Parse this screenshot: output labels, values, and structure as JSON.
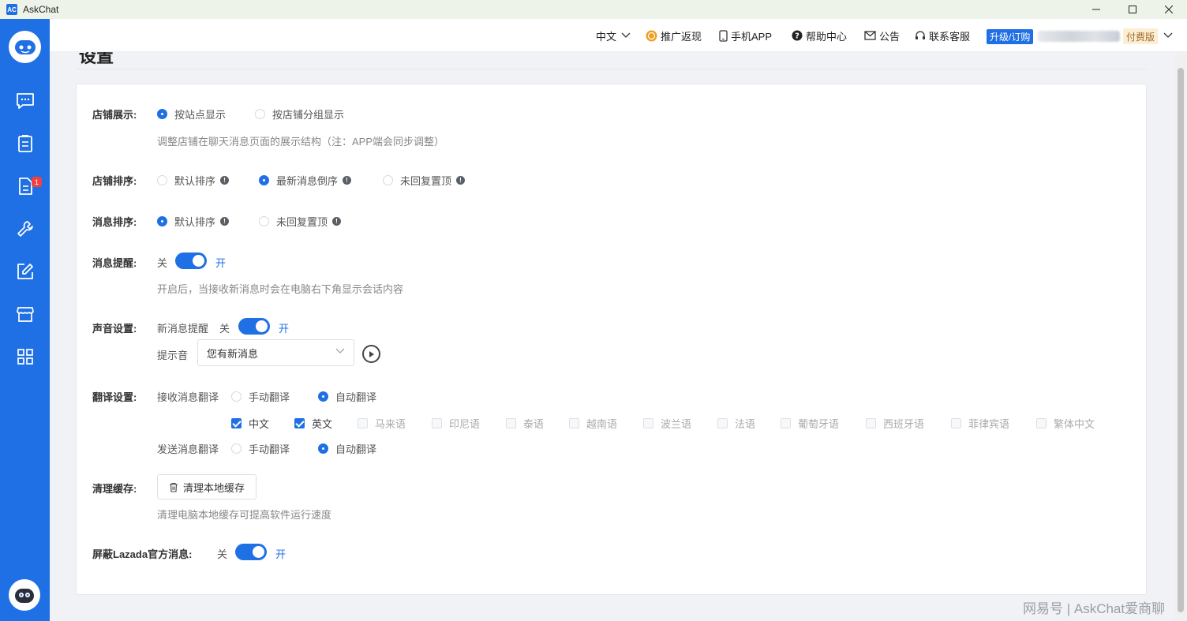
{
  "window": {
    "title": "AskChat",
    "app_icon_text": "AC"
  },
  "topbar": {
    "language": "中文",
    "promo": "推广返现",
    "mobile_app": "手机APP",
    "help": "帮助中心",
    "notice": "公告",
    "support": "联系客服",
    "upgrade": "升级/订购",
    "plan": "付费版"
  },
  "sidebar": {
    "badge": "1"
  },
  "page": {
    "title": "设置"
  },
  "settings": {
    "shop_display": {
      "label": "店铺展示:",
      "opt1": "按站点显示",
      "opt2": "按店铺分组显示",
      "hint": "调整店铺在聊天消息页面的展示结构（注：APP端会同步调整）"
    },
    "shop_sort": {
      "label": "店铺排序:",
      "opt1": "默认排序",
      "opt2": "最新消息倒序",
      "opt3": "未回复置顶"
    },
    "msg_sort": {
      "label": "消息排序:",
      "opt1": "默认排序",
      "opt2": "未回复置顶"
    },
    "msg_notify": {
      "label": "消息提醒:",
      "off": "关",
      "on": "开",
      "hint": "开启后，当接收新消息时会在电脑右下角显示会话内容"
    },
    "sound": {
      "label": "声音设置:",
      "new_msg": "新消息提醒",
      "off": "关",
      "on": "开",
      "tone_label": "提示音",
      "tone_value": "您有新消息"
    },
    "translate": {
      "label": "翻译设置:",
      "receive": "接收消息翻译",
      "send": "发送消息翻译",
      "manual": "手动翻译",
      "auto": "自动翻译",
      "languages": [
        "中文",
        "英文",
        "马来语",
        "印尼语",
        "泰语",
        "越南语",
        "波兰语",
        "法语",
        "葡萄牙语",
        "西班牙语",
        "菲律宾语",
        "繁体中文"
      ]
    },
    "cache": {
      "label": "清理缓存:",
      "button": "清理本地缓存",
      "hint": "清理电脑本地缓存可提高软件运行速度"
    },
    "lazada": {
      "label": "屏蔽Lazada官方消息:",
      "off": "关",
      "on": "开"
    }
  },
  "watermark": "网易号 | AskChat爱商聊"
}
